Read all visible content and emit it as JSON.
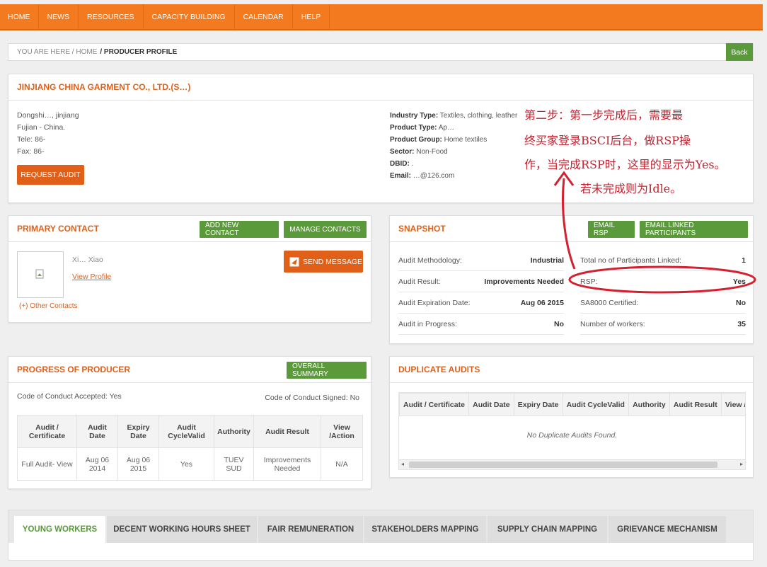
{
  "nav": {
    "items": [
      "HOME",
      "NEWS",
      "RESOURCES",
      "CAPACITY BUILDING",
      "CALENDAR",
      "HELP"
    ]
  },
  "breadcrumb": {
    "prefix": "YOU ARE HERE  / HOME",
    "current": "/ PRODUCER PROFILE",
    "back": "Back"
  },
  "producer": {
    "name": "JINJIANG CHINA GARMENT CO., LTD.(S…)",
    "address_line1": "Dongshi…, jinjiang",
    "address_line2": "Fujian - China.",
    "tel": "Tele: 86-",
    "fax": "Fax: 86-",
    "request_audit": "REQUEST AUDIT",
    "info": [
      {
        "label": "Industry Type:",
        "value": "Textiles, clothing, leather"
      },
      {
        "label": "Product Type:",
        "value": "Ap…"
      },
      {
        "label": "Product Group:",
        "value": "Home textiles"
      },
      {
        "label": "Sector:",
        "value": "Non-Food"
      },
      {
        "label": "DBID:",
        "value": "."
      },
      {
        "label": "Email:",
        "value": "…@126.com"
      }
    ]
  },
  "primary_contact": {
    "title": "PRIMARY CONTACT",
    "add_new": "ADD NEW CONTACT",
    "manage": "MANAGE CONTACTS",
    "name": "Xi… Xiao",
    "view_profile": "View Profile",
    "send_message": "SEND MESSAGE",
    "other_contacts": "(+) Other Contacts"
  },
  "snapshot": {
    "title": "SNAPSHOT",
    "email_rsp": "EMAIL RSP",
    "email_linked": "EMAIL LINKED PARTICIPANTS",
    "left": [
      {
        "label": "Audit Methodology:",
        "value": "Industrial"
      },
      {
        "label": "Audit Result:",
        "value": "Improvements Needed"
      },
      {
        "label": "Audit Expiration Date:",
        "value": "Aug 06 2015"
      },
      {
        "label": "Audit in Progress:",
        "value": "No"
      }
    ],
    "right": [
      {
        "label": "Total no of Participants Linked:",
        "value": "1"
      },
      {
        "label": "RSP:",
        "value": "Yes"
      },
      {
        "label": "SA8000 Certified:",
        "value": "No"
      },
      {
        "label": "Number of workers:",
        "value": "35"
      }
    ]
  },
  "progress": {
    "title": "PROGRESS OF PRODUCER",
    "overall_summary": "OVERALL SUMMARY",
    "coc_accepted": "Code of Conduct Accepted: Yes",
    "coc_signed": "Code of Conduct Signed: No",
    "headers": [
      "Audit / Certificate",
      "Audit Date",
      "Expiry Date",
      "Audit CycleValid",
      "Authority",
      "Audit Result",
      "View /Action"
    ],
    "row": [
      "Full Audit- View",
      "Aug 06 2014",
      "Aug 06 2015",
      "Yes",
      "TUEV SUD",
      "Improvements Needed",
      "N/A"
    ]
  },
  "duplicate": {
    "title": "DUPLICATE AUDITS",
    "headers": [
      "Audit / Certificate",
      "Audit Date",
      "Expiry Date",
      "Audit CycleValid",
      "Authority",
      "Audit Result",
      "View /Ac"
    ],
    "empty": "No Duplicate Audits Found."
  },
  "tabs": [
    "YOUNG WORKERS",
    "DECENT WORKING HOURS SHEET",
    "FAIR REMUNERATION",
    "STAKEHOLDERS MAPPING",
    "SUPPLY CHAIN MAPPING",
    "GRIEVANCE MECHANISM"
  ],
  "annotation": {
    "line1": "第二步：第一步完成后，需要最",
    "line2": "终买家登录BSCI后台，做RSP操",
    "line3": "作，当完成RSP时，这里的显示为Yes。",
    "line4": "若未完成则为Idle。"
  },
  "colors": {
    "brand_orange": "#f47a20",
    "title_orange": "#e0601a",
    "green": "#5b9a3a",
    "annotation_red": "#c7202e"
  }
}
